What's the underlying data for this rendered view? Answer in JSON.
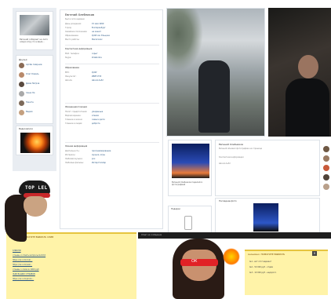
{
  "profile": {
    "name": "Евгений Хлебников",
    "status_line": "был в сети недавно",
    "avatar_caption": "Евгений собирает на лето новую игру по новым...",
    "friends_header": "Друзья",
    "friends": [
      "Артём Смирнов",
      "Олег Коваль",
      "Дима Петров",
      "Саша Ли",
      "Никита",
      "Вадим"
    ],
    "video_header": "Видеозаписи"
  },
  "info": {
    "rows": [
      {
        "k": "День рождения:",
        "v": "15 мая 1999"
      },
      {
        "k": "Город:",
        "v": "Екатеринбург"
      },
      {
        "k": "Семейное положение:",
        "v": "не женат"
      },
      {
        "k": "Образование:",
        "v": "УрФУ им. Ельцина"
      },
      {
        "k": "Место работы:",
        "v": "Мегаполис"
      }
    ],
    "section_contacts": "Контактная информация",
    "contact_rows": [
      {
        "k": "Моб. телефон:",
        "v": "скрыт"
      },
      {
        "k": "Skype:",
        "v": "khlebnikov"
      }
    ],
    "section_edu": "Образование",
    "edu_rows": [
      {
        "k": "ВУЗ:",
        "v": "УрФУ"
      },
      {
        "k": "Факультет:",
        "v": "ИРИТ-РтФ"
      },
      {
        "k": "Школа:",
        "v": "Школа №52"
      }
    ],
    "section_life": "Жизненная позиция",
    "life_rows": [
      {
        "k": "Полит. предпочтения:",
        "v": "умеренные"
      },
      {
        "k": "Мировоззрение:",
        "v": "атеизм"
      },
      {
        "k": "Главное в жизни:",
        "v": "семья и дети"
      },
      {
        "k": "Главное в людях:",
        "v": "доброта"
      }
    ],
    "section_interests": "Личная информация",
    "interest_rows": [
      {
        "k": "Деятельность:",
        "v": "программирование"
      },
      {
        "k": "Интересы:",
        "v": "музыка, игры"
      },
      {
        "k": "Любимая музыка:",
        "v": "рок"
      },
      {
        "k": "Любимые фильмы:",
        "v": "Интерстеллар"
      }
    ]
  },
  "wall": {
    "mini_caption": "Евгений Хлебников поделился фотографией",
    "post_name": "Евгений Хлебников",
    "post_lines": [
      "Евгений обновил фотографию на странице",
      "Контактная информация",
      "Школа №52"
    ],
    "gifts_header": "Подарки",
    "photo_post_header": "Последние фото"
  },
  "overlay": {
    "cap_text": "TOP LEL",
    "band_text": "ОК",
    "left_head": "Анонимно: ПОМОГИТЕ ВЫБРАТЬ СЛИВ",
    "left_lines": [
      "КЛИКНИ",
      "отзывы и ответы вопросы №1010",
      "https://vk.com/club...",
      "https://vk.com/wall...",
      "отзывы о слив за 1000 руб",
      "ЖДУ ВАШИХ ОТЗЫВОВ",
      "https://vk.com/photo..."
    ],
    "dark_bar_text": "Ответ на сообщение",
    "right_head": "Анонимно: ПОМОГИТЕ ВЫБРАТЬ",
    "right_lines": [
      "№1 - вот этот вариант",
      "№2 - 50 000 руб - отдам",
      "№3 - 10 000 руб - недорого"
    ],
    "close_label": "×"
  }
}
